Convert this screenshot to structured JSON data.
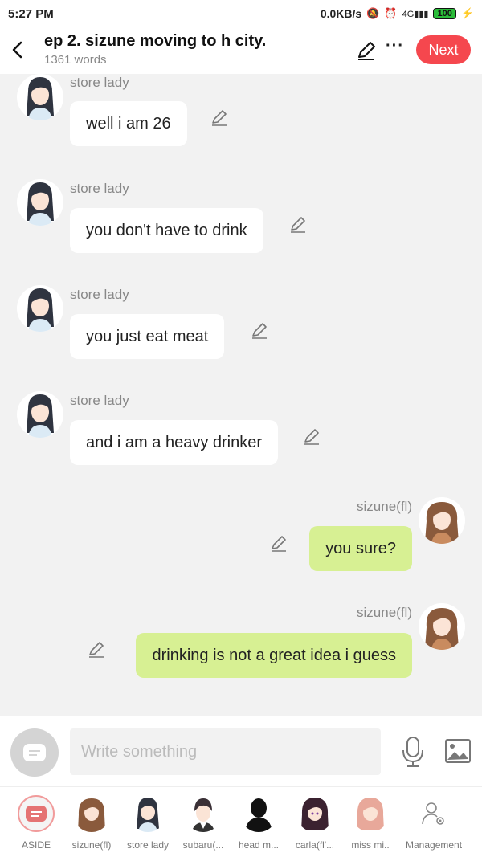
{
  "status": {
    "time": "5:27 PM",
    "speed": "0.0KB/s",
    "network": "4G",
    "battery": "100"
  },
  "header": {
    "title": "ep 2. sizune moving to h city.",
    "word_count": "1361 words",
    "next_label": "Next",
    "more_label": "···"
  },
  "messages": [
    {
      "side": "left",
      "speaker": "store lady",
      "text": "well i am 26"
    },
    {
      "side": "left",
      "speaker": "store lady",
      "text": "you don't have to drink"
    },
    {
      "side": "left",
      "speaker": "store lady",
      "text": "you just eat meat"
    },
    {
      "side": "left",
      "speaker": "store lady",
      "text": "and i am a heavy drinker"
    },
    {
      "side": "right",
      "speaker": "sizune(fl)",
      "text": "you sure?"
    },
    {
      "side": "right",
      "speaker": "sizune(fl)",
      "text": "drinking is not a great idea i guess"
    }
  ],
  "input": {
    "placeholder": "Write something",
    "value": ""
  },
  "characters": [
    {
      "label": "ASIDE",
      "icon": "aside-icon"
    },
    {
      "label": "sizune(fl)",
      "icon": "avatar-sizune"
    },
    {
      "label": "store lady",
      "icon": "avatar-store-lady"
    },
    {
      "label": "subaru(...",
      "icon": "avatar-subaru"
    },
    {
      "label": "head m...",
      "icon": "avatar-silhouette"
    },
    {
      "label": "carla(fl'...",
      "icon": "avatar-carla"
    },
    {
      "label": "miss mi..",
      "icon": "avatar-miss-mi"
    },
    {
      "label": "Management",
      "icon": "management-icon"
    }
  ],
  "colors": {
    "accent": "#f5474e",
    "right_bubble": "#d7f093",
    "left_bubble": "#ffffff",
    "background": "#f2f2f2"
  }
}
